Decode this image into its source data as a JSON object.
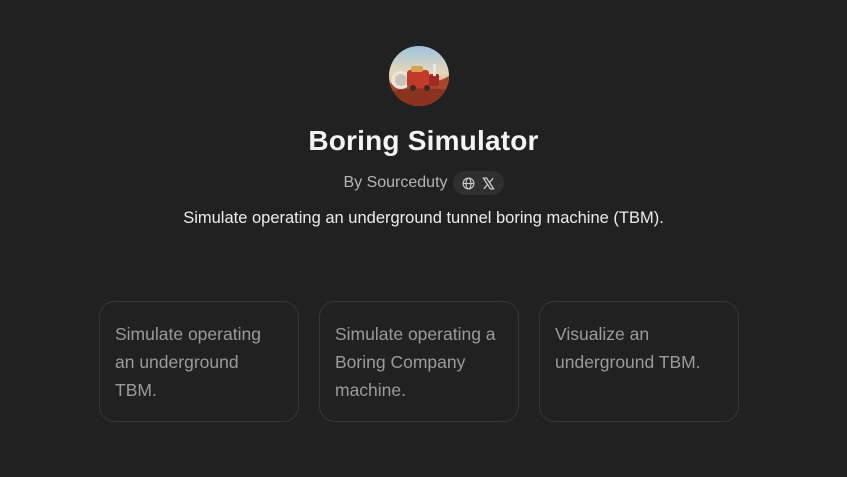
{
  "gpt": {
    "avatar_icon": "boring-machine-avatar",
    "title": "Boring Simulator",
    "author": "By Sourceduty",
    "social_icons": [
      "globe-icon",
      "x-icon"
    ],
    "description": "Simulate operating an underground tunnel boring machine (TBM)."
  },
  "starters": [
    {
      "text": "Simulate operating an underground TBM."
    },
    {
      "text": "Simulate operating a Boring Company machine."
    },
    {
      "text": "Visualize an underground TBM."
    }
  ],
  "colors": {
    "background": "#212121",
    "card_border": "#363636",
    "title": "#f4f4f4",
    "muted": "#b4b4b4",
    "starter_text": "#9b9b9b"
  }
}
